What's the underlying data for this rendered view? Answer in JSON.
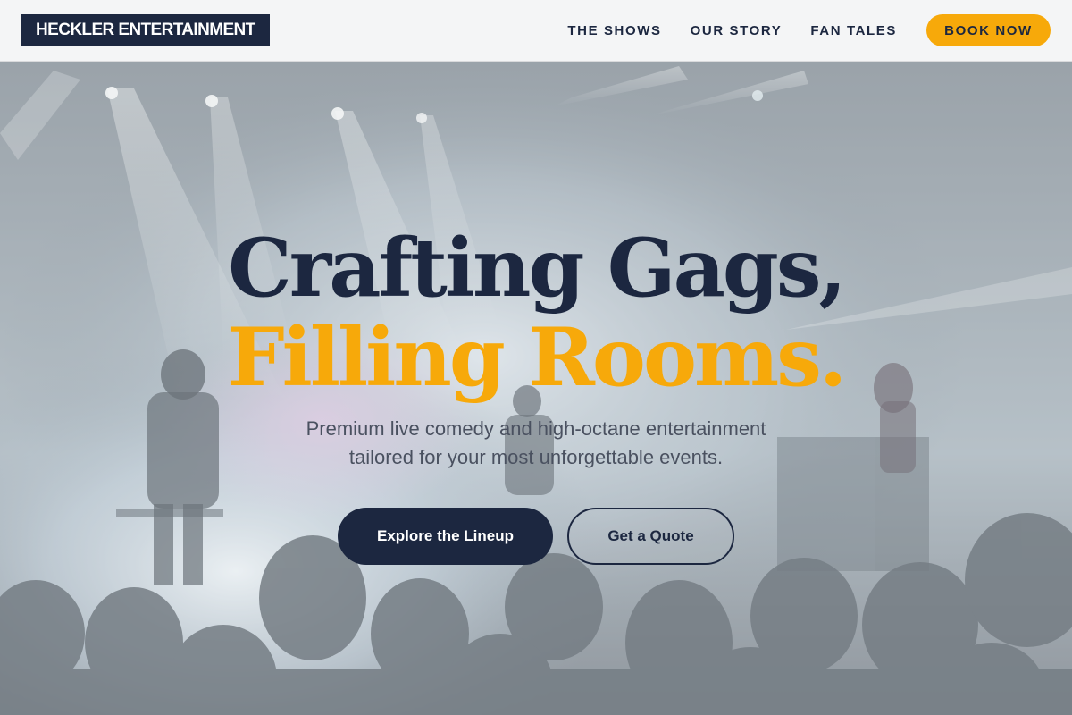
{
  "header": {
    "logo": "HECKLER ENTERTAINMENT",
    "nav": [
      {
        "label": "THE SHOWS"
      },
      {
        "label": "OUR STORY"
      },
      {
        "label": "FAN TALES"
      }
    ],
    "cta_label": "BOOK NOW"
  },
  "hero": {
    "headline_line1": "Crafting Gags,",
    "headline_line2": "Filling Rooms.",
    "subtitle_line1": "Premium live comedy and high-octane entertainment",
    "subtitle_line2": "tailored for your most unforgettable events.",
    "primary_button": "Explore the Lineup",
    "secondary_button": "Get a Quote",
    "background_image": "concert-stage-photo"
  },
  "colors": {
    "navy": "#1c2740",
    "accent": "#f7a90a",
    "header_bg": "#f4f5f6"
  }
}
